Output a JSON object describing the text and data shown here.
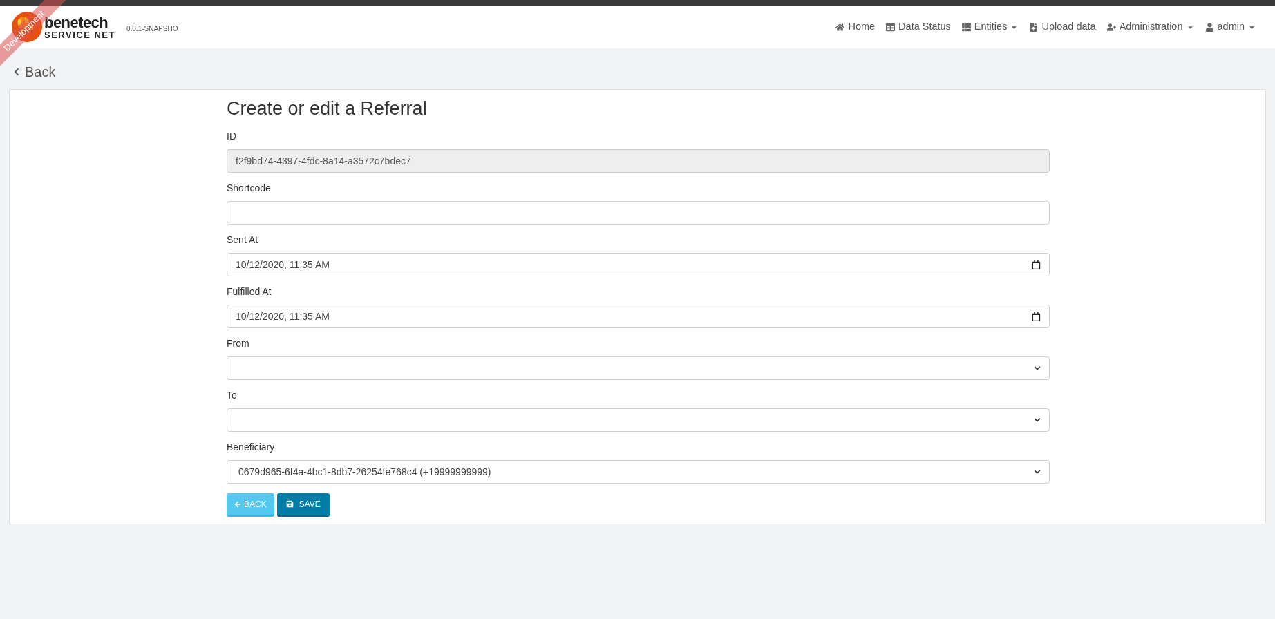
{
  "ribbon": "Development",
  "brand": {
    "name": "benetech",
    "subtitle": "SERVICE NET",
    "version": "0.0.1-SNAPSHOT"
  },
  "nav": [
    {
      "label": "Home",
      "dropdown": false
    },
    {
      "label": "Data Status",
      "dropdown": false
    },
    {
      "label": "Entities",
      "dropdown": true
    },
    {
      "label": "Upload data",
      "dropdown": false
    },
    {
      "label": "Administration",
      "dropdown": true
    },
    {
      "label": "admin",
      "dropdown": true
    }
  ],
  "back_link": "Back",
  "form": {
    "title": "Create or edit a Referral",
    "fields": [
      {
        "label": "ID",
        "kind": "text",
        "value": "f2f9bd74-4397-4fdc-8a14-a3572c7bdec7",
        "disabled": true
      },
      {
        "label": "Shortcode",
        "kind": "text",
        "disabled": false
      },
      {
        "label": "Sent At",
        "kind": "date",
        "value": "10/12/2020, 11:35 AM",
        "disabled": false
      },
      {
        "label": "Fulfilled At",
        "kind": "date",
        "value": "10/12/2020, 11:35 AM",
        "disabled": false
      },
      {
        "label": "From",
        "kind": "select",
        "disabled": false
      },
      {
        "label": "To",
        "kind": "select",
        "disabled": false
      },
      {
        "label": "Beneficiary",
        "kind": "select",
        "value": "0679d965-6f4a-4bc1-8db7-26254fe768c4 (+19999999999)",
        "disabled": false
      }
    ],
    "buttons": [
      {
        "label": "BACK",
        "kind": "back"
      },
      {
        "label": "SAVE",
        "kind": "save"
      }
    ]
  }
}
